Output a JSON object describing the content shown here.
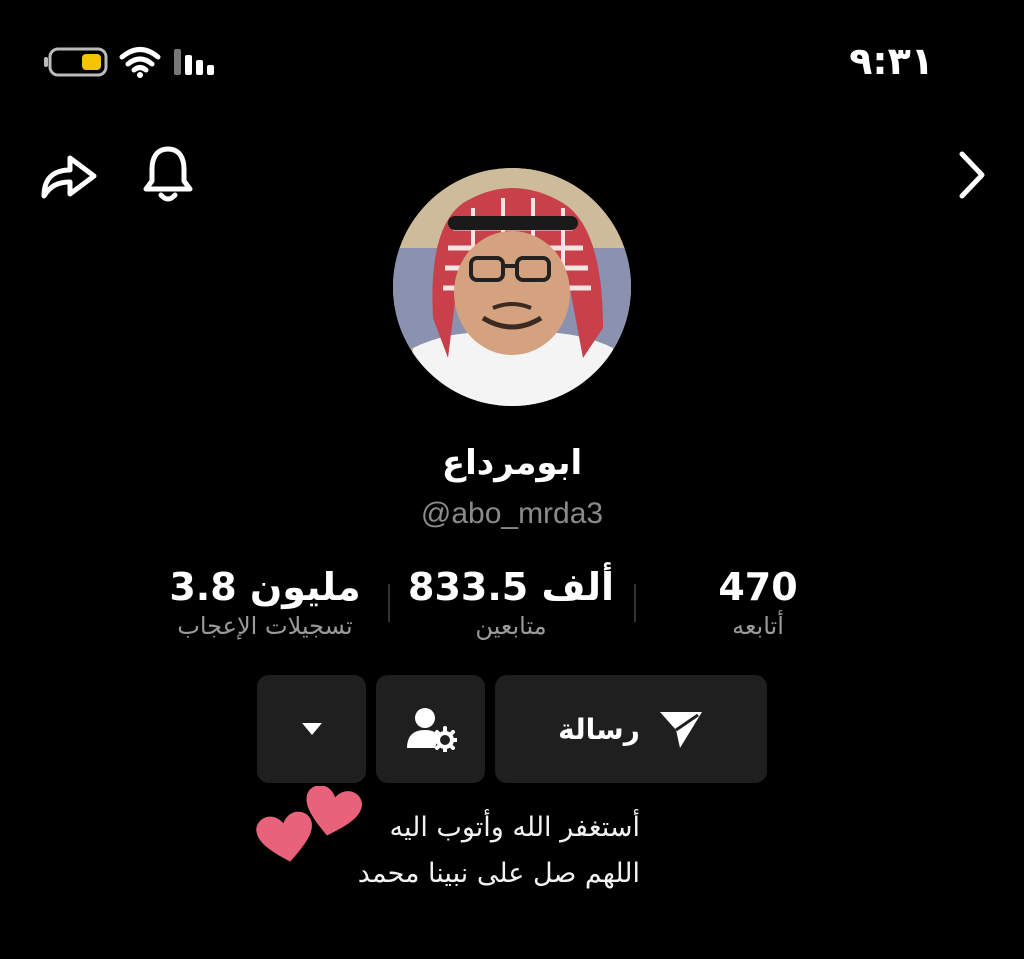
{
  "status_bar": {
    "time": "٩:٣١",
    "battery_icon": "battery-low-icon",
    "battery_color": "#f5c400",
    "wifi_icon": "wifi-icon",
    "signal_icon": "signal-icon"
  },
  "nav": {
    "share_icon": "share-icon",
    "bell_icon": "bell-icon",
    "forward_icon": "chevron-right-icon"
  },
  "profile": {
    "display_name": "ابومرداع",
    "handle": "@abo_mrda3"
  },
  "stats": [
    {
      "value": "470",
      "label": "أتابعه"
    },
    {
      "value": "833.5 ألف",
      "label": "متابعين"
    },
    {
      "value": "3.8 مليون",
      "label": "تسجيلات الإعجاب"
    }
  ],
  "actions": {
    "message_label": "رسالة",
    "message_icon": "send-icon",
    "settings_icon": "user-settings-icon",
    "dropdown_icon": "caret-down-icon"
  },
  "bio": {
    "line1": "أستغفر الله وأتوب اليه",
    "line2": "اللهم صل على نبينا محمد",
    "hearts_color": "#e8637a"
  }
}
